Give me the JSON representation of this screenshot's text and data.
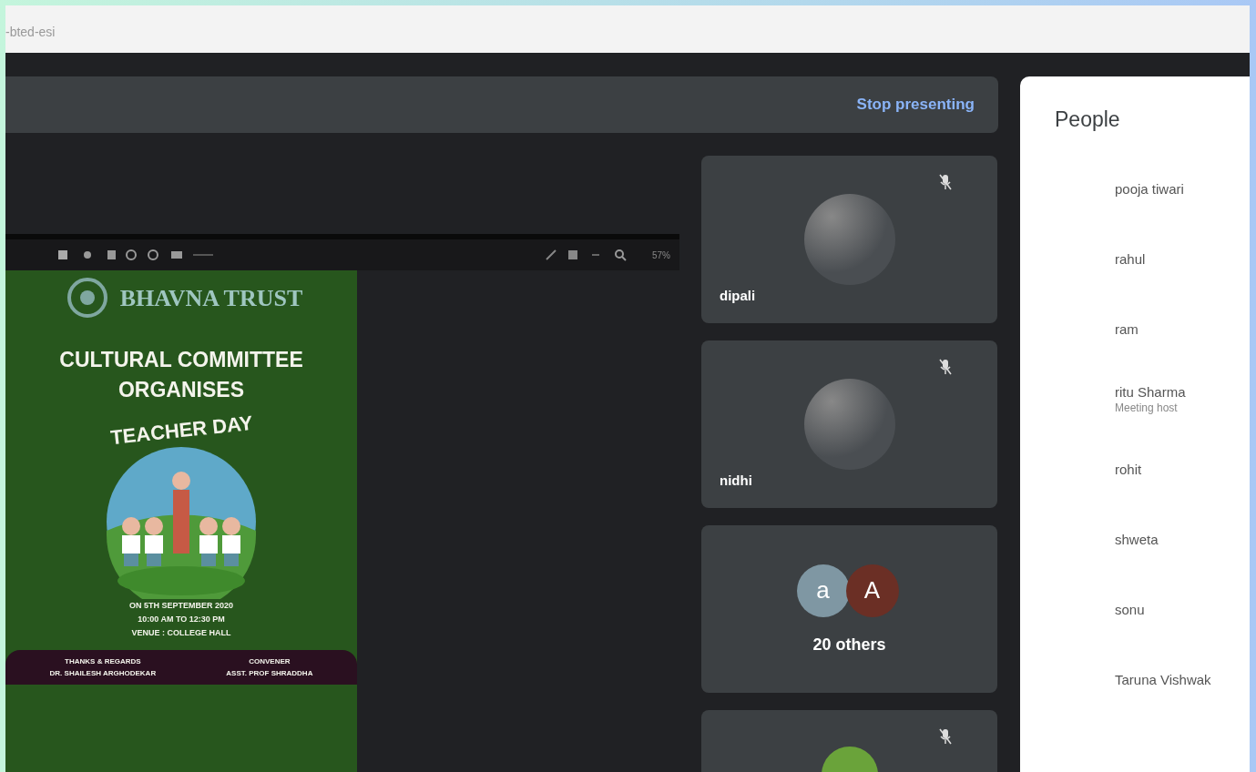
{
  "address_bar": {
    "text": "-bted-esi"
  },
  "presentation_bar": {
    "button": "Stop presenting"
  },
  "viewer_toolbar": {
    "zoom": "57%"
  },
  "poster": {
    "org": "BHAVNA TRUST",
    "headline": [
      "CULTURAL COMMITTEE",
      "ORGANISES"
    ],
    "badge": "TEACHER DAY",
    "details": [
      "ON 5TH SEPTEMBER 2020",
      "10:00 AM TO 12:30 PM",
      "VENUE : COLLEGE HALL"
    ],
    "footer": [
      {
        "title": "THANKS & REGARDS",
        "name": "DR. SHAILESH ARGHODEKAR"
      },
      {
        "title": "CONVENER",
        "name": "ASST. PROF SHRADDHA"
      }
    ]
  },
  "tiles": [
    {
      "kind": "participant",
      "name": "dipali",
      "muted": true
    },
    {
      "kind": "participant",
      "name": "nidhi",
      "muted": true
    },
    {
      "kind": "others",
      "label": "20 others",
      "avatars": [
        {
          "letter": "a",
          "color": "#7f97a3"
        },
        {
          "letter": "A",
          "color": "#6b2f25"
        }
      ]
    },
    {
      "kind": "partial",
      "muted": true
    }
  ],
  "people": {
    "title": "People",
    "members": [
      {
        "name": "pooja tiwari"
      },
      {
        "name": "rahul"
      },
      {
        "name": "ram"
      },
      {
        "name": "ritu Sharma",
        "role": "Meeting host"
      },
      {
        "name": "rohit"
      },
      {
        "name": "shweta"
      },
      {
        "name": "sonu"
      },
      {
        "name": "Taruna Vishwak"
      }
    ]
  }
}
